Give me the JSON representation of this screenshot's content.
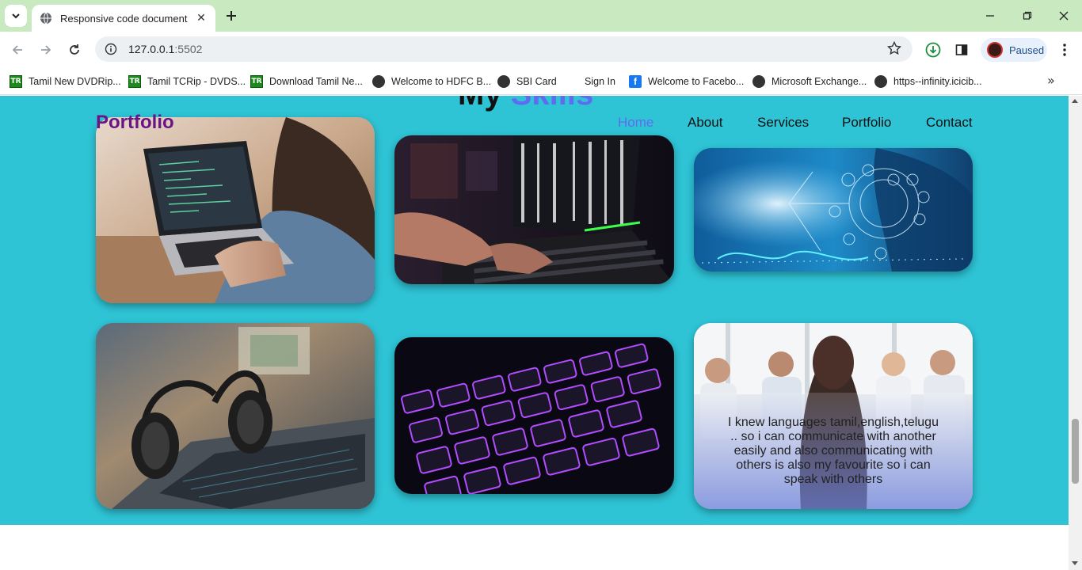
{
  "browser": {
    "tab_title": "Responsive code document",
    "url_host": "127.0.0.1",
    "url_port": ":5502",
    "profile_status": "Paused",
    "bookmarks": [
      {
        "label": "Tamil New DVDRip...",
        "icon": "tr-icon"
      },
      {
        "label": "Tamil TCRip - DVDS...",
        "icon": "tr-icon"
      },
      {
        "label": "Download Tamil Ne...",
        "icon": "tr-icon"
      },
      {
        "label": "Welcome to HDFC B...",
        "icon": "globe-icon"
      },
      {
        "label": "SBI Card",
        "icon": "globe-icon"
      },
      {
        "label": "Sign In",
        "icon": "microsoft-icon"
      },
      {
        "label": "Welcome to Facebo...",
        "icon": "facebook-icon"
      },
      {
        "label": "Microsoft Exchange...",
        "icon": "globe-icon"
      },
      {
        "label": "https--infinity.icicib...",
        "icon": "globe-icon"
      }
    ]
  },
  "page": {
    "heading_part1": "My",
    "heading_part2": "Skills",
    "logo": "Portfolio",
    "nav": [
      "Home",
      "About",
      "Services",
      "Portfolio",
      "Contact"
    ],
    "active_nav": "Home",
    "accent_color": "#5e6cf0",
    "background_color": "#2ec4d6",
    "logo_color": "#6a1585",
    "cards": [
      {
        "image": "woman-coding-on-laptop"
      },
      {
        "image": "hands-typing-code-laptop"
      },
      {
        "image": "digital-network-icons"
      },
      {
        "image": "headphones-on-laptop"
      },
      {
        "image": "purple-backlit-keyboard"
      },
      {
        "image": "business-meeting",
        "overlay_text": "I knew languages tamil,english,telugu .. so i can communicate with another easily and also communicating with others is also my favourite so i can speak with others"
      }
    ]
  }
}
